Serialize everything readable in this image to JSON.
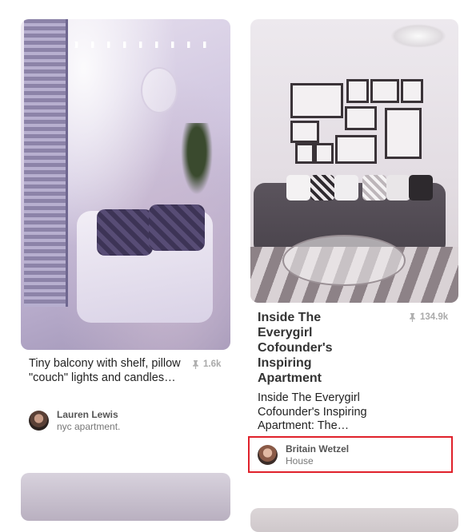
{
  "pins": [
    {
      "title": "Tiny balcony with shelf, pillow \"couch\" lights and candles…",
      "repins": "1.6k",
      "pinner_name": "Lauren Lewis",
      "board": "nyc apartment."
    },
    {
      "title": "Inside The Everygirl Cofounder's Inspiring Apartment",
      "description": "Inside The Everygirl Cofounder's Inspiring Apartment: The…",
      "repins": "134.9k",
      "pinner_name": "Britain Wetzel",
      "board": "House"
    }
  ],
  "icons": {
    "repin": "pin-icon"
  },
  "colors": {
    "highlight": "#e0212b",
    "meta_gray": "#aaaaaa"
  }
}
